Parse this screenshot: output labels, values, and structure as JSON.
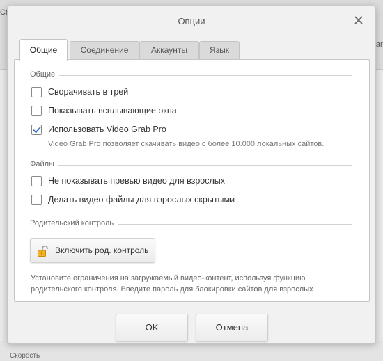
{
  "background": {
    "left_tab_fragment": "Сп",
    "right_tab_fragment": "Заг",
    "speed_label": "Скорость"
  },
  "dialog": {
    "title": "Опции",
    "close_icon": "close-icon"
  },
  "tabs": [
    {
      "label": "Общие",
      "active": true
    },
    {
      "label": "Соединение",
      "active": false
    },
    {
      "label": "Аккаунты",
      "active": false
    },
    {
      "label": "Язык",
      "active": false
    }
  ],
  "general": {
    "heading": "Общие",
    "options": [
      {
        "label": "Сворачивать в трей",
        "checked": false
      },
      {
        "label": "Показывать всплывающие окна",
        "checked": false
      },
      {
        "label": "Использовать Video Grab Pro",
        "checked": true
      }
    ],
    "video_grab_hint": "Video Grab Pro позволяет скачивать видео с более 10.000 локальных сайтов."
  },
  "files": {
    "heading": "Файлы",
    "options": [
      {
        "label": "Не показывать превью видео для взрослых",
        "checked": false
      },
      {
        "label": "Делать видео файлы для взрослых скрытыми",
        "checked": false
      }
    ]
  },
  "parental": {
    "heading": "Родительский контроль",
    "button_label": "Включить род. контроль",
    "button_icon": "lock-open-icon",
    "description": "Установите ограничения на загружаемый видео-контент, используя функцию родительского контроля. Введите пароль для блокировки сайтов для взрослых"
  },
  "buttons": {
    "ok": "OK",
    "cancel": "Отмена"
  },
  "colors": {
    "checkmark": "#2a6fc9",
    "lock": "#e0a020"
  }
}
